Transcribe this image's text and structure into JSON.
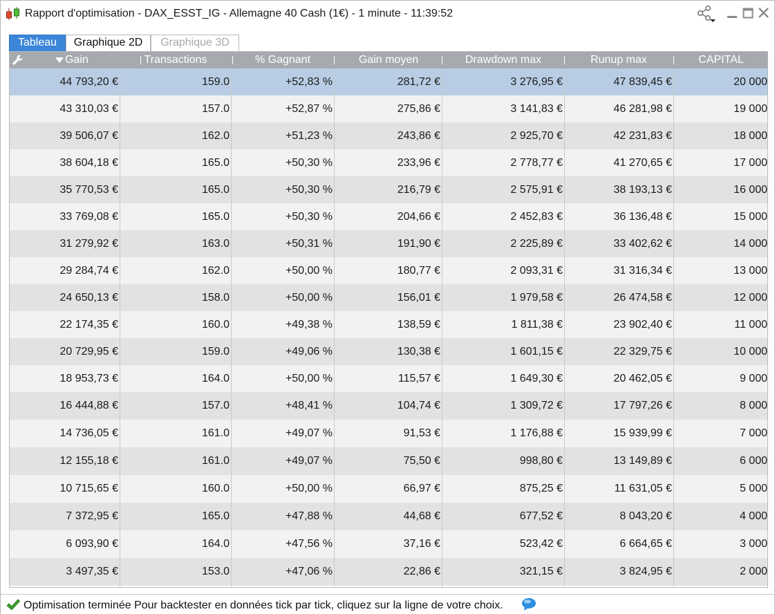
{
  "window": {
    "title": "Rapport d'optimisation - DAX_ESST_IG - Allemagne 40 Cash (1€) - 1 minute - 11:39:52",
    "icons": [
      "candlestick-chart-icon",
      "share-icon",
      "minimize-icon",
      "maximize-icon",
      "close-icon"
    ]
  },
  "tabs": [
    {
      "label": "Tableau",
      "state": "active"
    },
    {
      "label": "Graphique 2D",
      "state": "normal"
    },
    {
      "label": "Graphique 3D",
      "state": "disabled"
    }
  ],
  "table": {
    "sort_column": "Gain",
    "sort_direction": "descending",
    "columns": [
      "Gain",
      "Transactions",
      "% Gagnant",
      "Gain moyen",
      "Drawdown max",
      "Runup max",
      "CAPITAL"
    ],
    "selected_row": 0,
    "rows": [
      [
        "44 793,20 €",
        "159.0",
        "+52,83 %",
        "281,72 €",
        "3 276,95 €",
        "47 839,45 €",
        "20 000"
      ],
      [
        "43 310,03 €",
        "157.0",
        "+52,87 %",
        "275,86 €",
        "3 141,83 €",
        "46 281,98 €",
        "19 000"
      ],
      [
        "39 506,07 €",
        "162.0",
        "+51,23 %",
        "243,86 €",
        "2 925,70 €",
        "42 231,83 €",
        "18 000"
      ],
      [
        "38 604,18 €",
        "165.0",
        "+50,30 %",
        "233,96 €",
        "2 778,77 €",
        "41 270,65 €",
        "17 000"
      ],
      [
        "35 770,53 €",
        "165.0",
        "+50,30 %",
        "216,79 €",
        "2 575,91 €",
        "38 193,13 €",
        "16 000"
      ],
      [
        "33 769,08 €",
        "165.0",
        "+50,30 %",
        "204,66 €",
        "2 452,83 €",
        "36 136,48 €",
        "15 000"
      ],
      [
        "31 279,92 €",
        "163.0",
        "+50,31 %",
        "191,90 €",
        "2 225,89 €",
        "33 402,62 €",
        "14 000"
      ],
      [
        "29 284,74 €",
        "162.0",
        "+50,00 %",
        "180,77 €",
        "2 093,31 €",
        "31 316,34 €",
        "13 000"
      ],
      [
        "24 650,13 €",
        "158.0",
        "+50,00 %",
        "156,01 €",
        "1 979,58 €",
        "26 474,58 €",
        "12 000"
      ],
      [
        "22 174,35 €",
        "160.0",
        "+49,38 %",
        "138,59 €",
        "1 811,38 €",
        "23 902,40 €",
        "11 000"
      ],
      [
        "20 729,95 €",
        "159.0",
        "+49,06 %",
        "130,38 €",
        "1 601,15 €",
        "22 329,75 €",
        "10 000"
      ],
      [
        "18 953,73 €",
        "164.0",
        "+50,00 %",
        "115,57 €",
        "1 649,30 €",
        "20 462,05 €",
        "9 000"
      ],
      [
        "16 444,88 €",
        "157.0",
        "+48,41 %",
        "104,74 €",
        "1 309,72 €",
        "17 797,26 €",
        "8 000"
      ],
      [
        "14 736,05 €",
        "161.0",
        "+49,07 %",
        "91,53 €",
        "1 176,88 €",
        "15 939,99 €",
        "7 000"
      ],
      [
        "12 155,18 €",
        "161.0",
        "+49,07 %",
        "75,50 €",
        "998,80 €",
        "13 149,89 €",
        "6 000"
      ],
      [
        "10 715,65 €",
        "160.0",
        "+50,00 %",
        "66,97 €",
        "875,25 €",
        "11 631,05 €",
        "5 000"
      ],
      [
        "7 372,95 €",
        "165.0",
        "+47,88 %",
        "44,68 €",
        "677,52 €",
        "8 043,20 €",
        "4 000"
      ],
      [
        "6 093,90 €",
        "164.0",
        "+47,56 %",
        "37,16 €",
        "523,42 €",
        "6 664,65 €",
        "3 000"
      ],
      [
        "3 497,35 €",
        "153.0",
        "+47,06 %",
        "22,86 €",
        "321,15 €",
        "3 824,95 €",
        "2 000"
      ]
    ]
  },
  "status": {
    "text": "Optimisation terminée  Pour backtester en données tick par tick, cliquez sur la ligne de votre choix.",
    "icons": [
      "checkmark-icon",
      "help-bubble-icon"
    ]
  },
  "colors": {
    "active_tab": "#3b86d8",
    "header_bg": "#a6aaae",
    "selected_row": "#b8cde4",
    "row_alt": "#e2e2e2",
    "row_plain": "#f2f2f2"
  }
}
